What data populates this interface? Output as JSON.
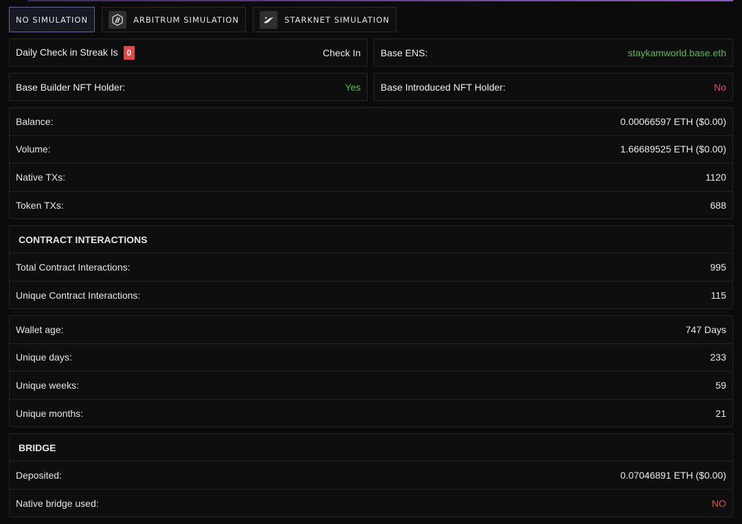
{
  "tabs": [
    {
      "label": "NO SIMULATION",
      "icon": "none",
      "active": true
    },
    {
      "label": "ARBITRUM SIMULATION",
      "icon": "arbitrum-icon",
      "active": false
    },
    {
      "label": "STARKNET SIMULATION",
      "icon": "starknet-icon",
      "active": false
    }
  ],
  "checkin": {
    "label": "Daily Check in Streak Is",
    "streak": "0",
    "button": "Check In"
  },
  "ens": {
    "label": "Base ENS:",
    "value": "staykamworld.base.eth"
  },
  "builder_nft": {
    "label": "Base Builder NFT Holder:",
    "value": "Yes"
  },
  "introduced_nft": {
    "label": "Base Introduced NFT Holder:",
    "value": "No"
  },
  "stats": [
    {
      "label": "Balance:",
      "value": "0.00066597 ETH ($0.00)"
    },
    {
      "label": "Volume:",
      "value": "1.66689525 ETH ($0.00)"
    },
    {
      "label": "Native TXs:",
      "value": "1120"
    },
    {
      "label": "Token TXs:",
      "value": "688"
    }
  ],
  "contracts": {
    "title": "CONTRACT INTERACTIONS",
    "rows": [
      {
        "label": "Total Contract Interactions:",
        "value": "995"
      },
      {
        "label": "Unique Contract Interactions:",
        "value": "115"
      }
    ]
  },
  "activity": [
    {
      "label": "Wallet age:",
      "value": "747 Days"
    },
    {
      "label": "Unique days:",
      "value": "233"
    },
    {
      "label": "Unique weeks:",
      "value": "59"
    },
    {
      "label": "Unique months:",
      "value": "21"
    }
  ],
  "bridge": {
    "title": "BRIDGE",
    "rows": [
      {
        "label": "Deposited:",
        "value": "0.07046891 ETH ($0.00)"
      },
      {
        "label": "Native bridge used:",
        "value": "NO"
      }
    ]
  },
  "colors": {
    "positive": "#5fb85a",
    "negative": "#e05252",
    "badge": "#e04747",
    "accent_line": "#8a5cc8"
  }
}
